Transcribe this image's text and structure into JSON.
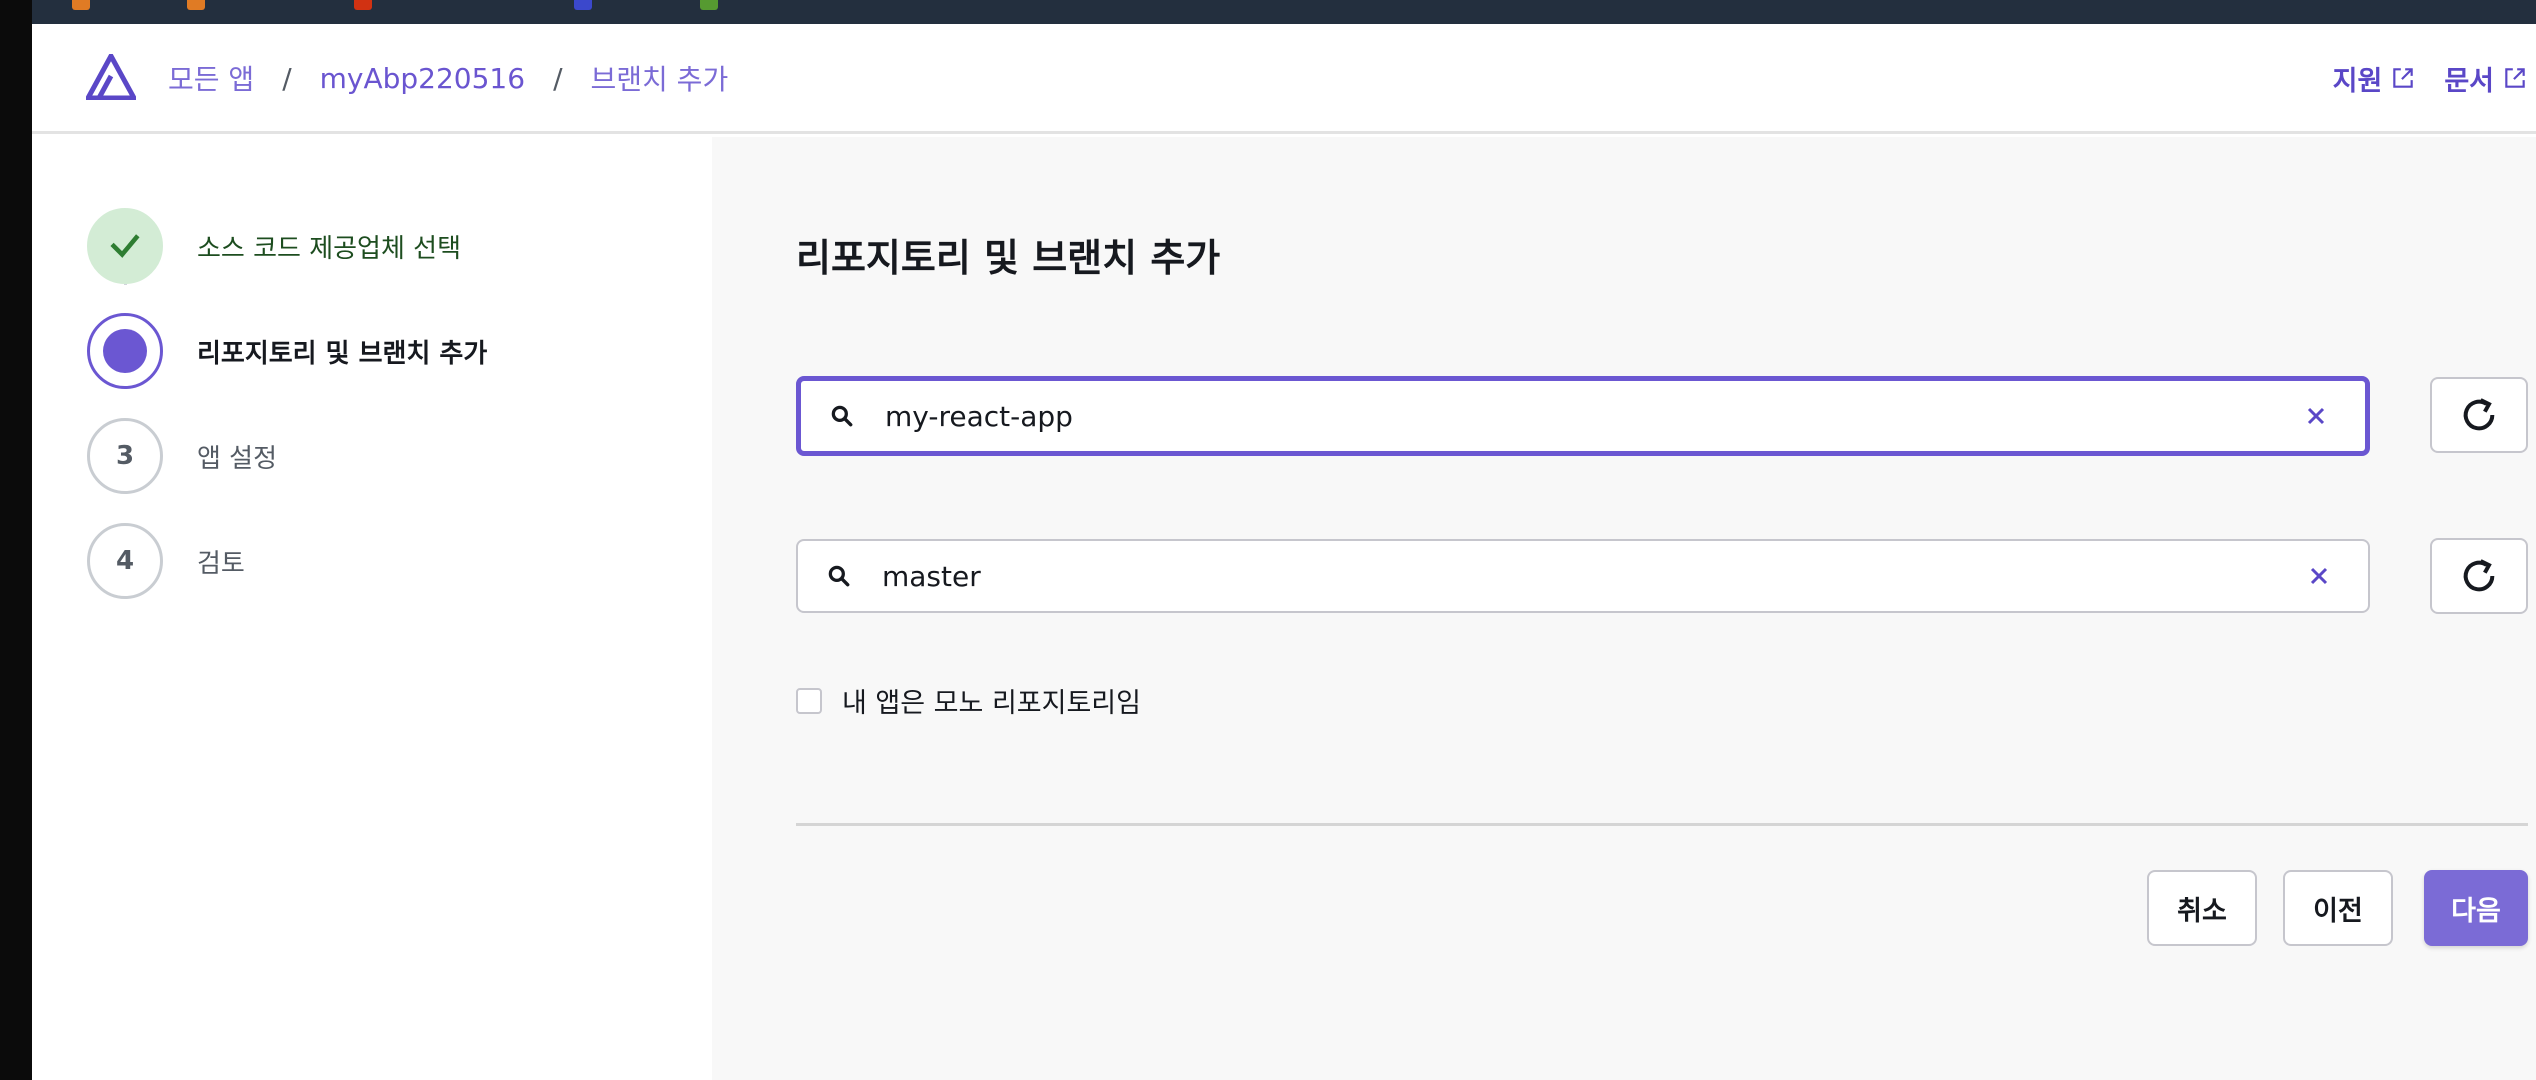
{
  "colors": {
    "accent": "#6b57d2",
    "primary_button": "#7b6bd6",
    "done_step_bg": "#d3ecd5",
    "done_check": "#2e7d32",
    "bookmark_bar": "#232f3e",
    "main_bg": "#f8f8f8"
  },
  "header": {
    "logo_icon": "amplify-logo-icon",
    "breadcrumb": {
      "all_apps": "모든 앱",
      "separator": "/",
      "app_name": "myAbp220516",
      "current": "브랜치 추가"
    },
    "links": {
      "support": "지원",
      "docs": "문서",
      "external_icon": "external-link-icon"
    }
  },
  "steps": {
    "step1": {
      "label": "소스 코드 제공업체 선택",
      "state": "done"
    },
    "step2": {
      "label": "리포지토리 및 브랜치 추가",
      "state": "active"
    },
    "step3": {
      "number": "3",
      "label": "앱 설정",
      "state": "pending"
    },
    "step4": {
      "number": "4",
      "label": "검토",
      "state": "pending"
    }
  },
  "main": {
    "title": "리포지토리 및 브랜치 추가",
    "repository_search": {
      "value": "my-react-app"
    },
    "branch_search": {
      "value": "master"
    },
    "monorepo_checkbox": {
      "label": "내 앱은 모노 리포지토리임",
      "checked": false
    },
    "buttons": {
      "cancel": "취소",
      "previous": "이전",
      "next": "다음"
    }
  }
}
